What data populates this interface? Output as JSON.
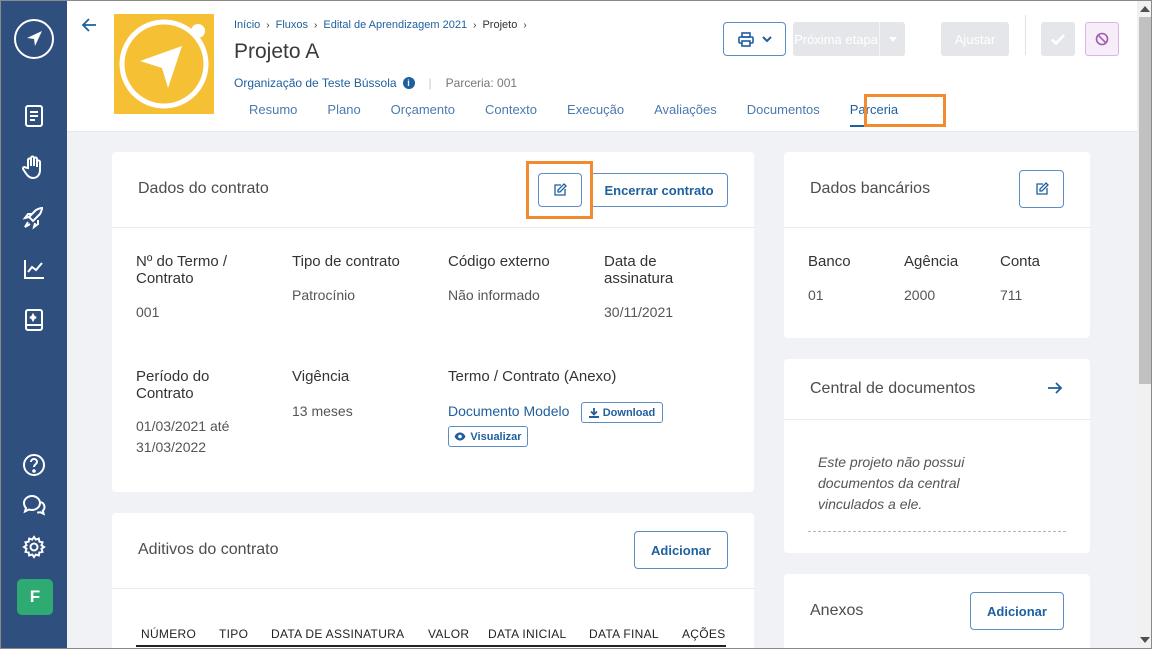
{
  "sidebar": {
    "logo": "bussola-logo-icon",
    "items": [
      "document-icon",
      "hand-heart-icon",
      "rocket-icon",
      "chart-line-icon",
      "notebook-icon"
    ],
    "bottom": [
      "help-icon",
      "chat-icon",
      "settings-icon"
    ],
    "avatar_letter": "F"
  },
  "header": {
    "breadcrumb": [
      "Início",
      "Fluxos",
      "Edital de Aprendizagem 2021",
      "Projeto"
    ],
    "title": "Projeto A",
    "organization": "Organização de Teste Bússola",
    "partnership": "Parceria: 001",
    "tabs": [
      "Resumo",
      "Plano",
      "Orçamento",
      "Contexto",
      "Execução",
      "Avaliações",
      "Documentos",
      "Parceria"
    ],
    "active_tab": "Parceria",
    "next_step_label": "Próxima etapa",
    "adjust_label": "Ajustar"
  },
  "contract": {
    "title": "Dados do contrato",
    "end_button": "Encerrar contrato",
    "fields": {
      "term_label": "Nº do Termo / Contrato",
      "term_value": "001",
      "type_label": "Tipo de contrato",
      "type_value": "Patrocínio",
      "code_label": "Código externo",
      "code_value": "Não informado",
      "sign_label": "Data de assinatura",
      "sign_value": "30/11/2021",
      "period_label": "Período do Contrato",
      "period_value": "01/03/2021 até 31/03/2022",
      "validity_label": "Vigência",
      "validity_value": "13 meses",
      "attachment_label": "Termo / Contrato (Anexo)",
      "attachment_link": "Documento Modelo",
      "download_label": "Download",
      "view_label": "Visualizar"
    }
  },
  "amendments": {
    "title": "Aditivos do contrato",
    "add_button": "Adicionar",
    "columns": [
      "NÚMERO",
      "TIPO",
      "DATA DE ASSINATURA",
      "VALOR",
      "DATA INICIAL",
      "DATA FINAL",
      "AÇÕES"
    ]
  },
  "bank": {
    "title": "Dados bancários",
    "bank_label": "Banco",
    "bank_value": "01",
    "agency_label": "Agência",
    "agency_value": "2000",
    "account_label": "Conta",
    "account_value": "711"
  },
  "documents": {
    "title": "Central de documentos",
    "empty_message": "Este projeto não possui documentos da central vinculados a ele."
  },
  "attachments": {
    "title": "Anexos",
    "add_button": "Adicionar"
  },
  "colors": {
    "sidebar": "#2f4f7f",
    "accent": "#1e5f9e",
    "highlight": "#f28a30",
    "project_image": "#f5c033",
    "avatar": "#2eab73"
  }
}
